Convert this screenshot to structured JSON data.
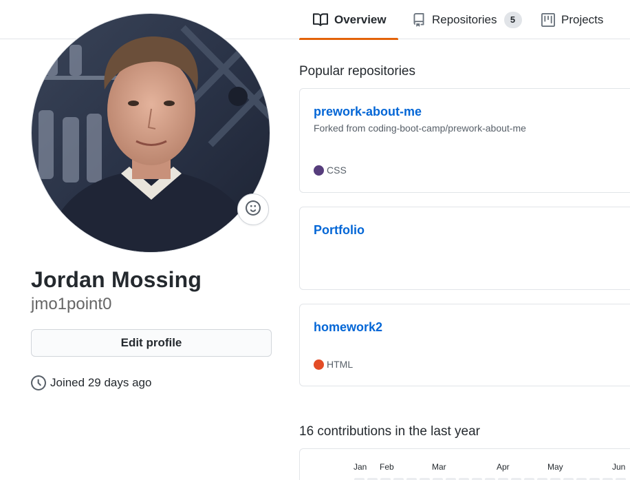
{
  "tabs": [
    {
      "label": "Overview",
      "icon": "book-icon",
      "active": true
    },
    {
      "label": "Repositories",
      "icon": "repo-icon",
      "count": "5"
    },
    {
      "label": "Projects",
      "icon": "project-icon"
    }
  ],
  "profile": {
    "name": "Jordan Mossing",
    "login": "jmo1point0",
    "edit_label": "Edit profile",
    "joined": "Joined 29 days ago",
    "status_icon": "smiley-icon"
  },
  "popular": {
    "title": "Popular repositories",
    "repos": [
      {
        "name": "prework-about-me",
        "fork": "Forked from coding-boot-camp/prework-about-me",
        "language": "CSS",
        "language_color": "#563d7c"
      },
      {
        "name": "Portfolio",
        "fork": "",
        "language": "",
        "language_color": ""
      },
      {
        "name": "homework2",
        "fork": "",
        "language": "HTML",
        "language_color": "#e34c26"
      }
    ]
  },
  "contributions": {
    "title": "16 contributions in the last year",
    "months": [
      "Jan",
      "Feb",
      "Mar",
      "Apr",
      "May",
      "Jun"
    ]
  },
  "colors": {
    "link": "#0366d6",
    "active_tab": "#e36209",
    "border": "#e1e4e8"
  }
}
